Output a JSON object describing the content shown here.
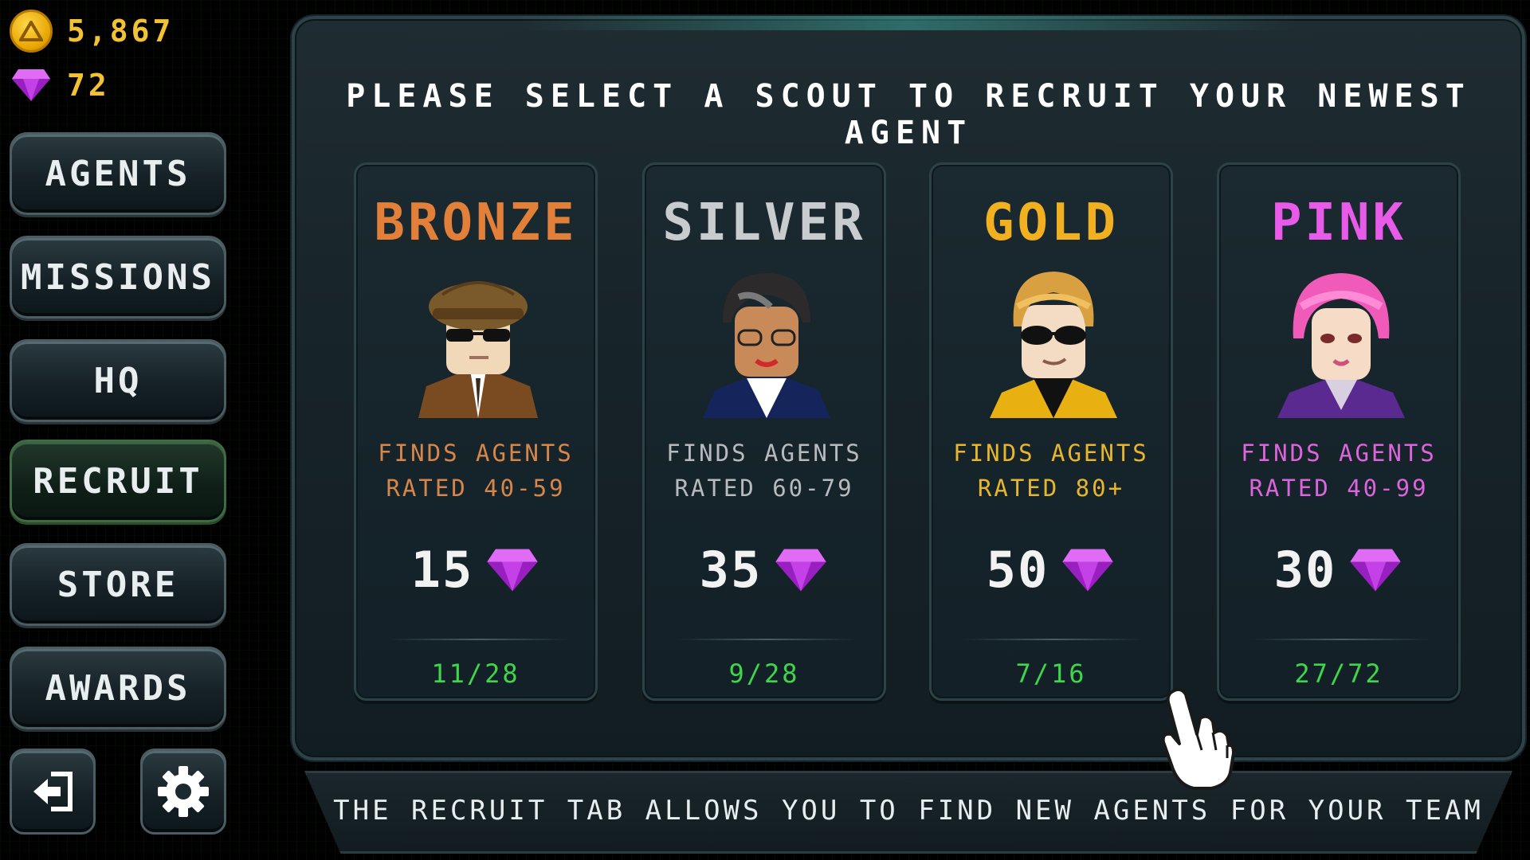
{
  "currency": {
    "coins": "5,867",
    "gems": "72"
  },
  "nav": {
    "agents": "AGENTS",
    "missions": "MISSIONS",
    "hq": "HQ",
    "recruit": "RECRUIT",
    "store": "STORE",
    "awards": "AWARDS",
    "active": "RECRUIT"
  },
  "title": "PLEASE SELECT A SCOUT TO RECRUIT YOUR NEWEST AGENT",
  "scouts": [
    {
      "name": "BRONZE",
      "desc_line1": "FINDS AGENTS",
      "desc_line2": "RATED 40-59",
      "cost": "15",
      "progress": "11/28",
      "color": "#e2803a",
      "desc_color": "#d7864a"
    },
    {
      "name": "SILVER",
      "desc_line1": "FINDS AGENTS",
      "desc_line2": "RATED 60-79",
      "cost": "35",
      "progress": "9/28",
      "color": "#c9ccce",
      "desc_color": "#b7bbbd"
    },
    {
      "name": "GOLD",
      "desc_line1": "FINDS AGENTS",
      "desc_line2": "RATED 80+",
      "cost": "50",
      "progress": "7/16",
      "color": "#f0b020",
      "desc_color": "#e8b62c"
    },
    {
      "name": "PINK",
      "desc_line1": "FINDS AGENTS",
      "desc_line2": "RATED 40-99",
      "cost": "30",
      "progress": "27/72",
      "color": "#e85ae8",
      "desc_color": "#dc64dc"
    }
  ],
  "footer": "THE RECRUIT TAB ALLOWS YOU TO FIND NEW AGENTS FOR YOUR TEAM",
  "icons": {
    "coin": "coin-icon",
    "gem": "gem-icon",
    "logout": "logout-icon",
    "settings": "gear-icon",
    "pointer": "hand-pointer-icon"
  }
}
